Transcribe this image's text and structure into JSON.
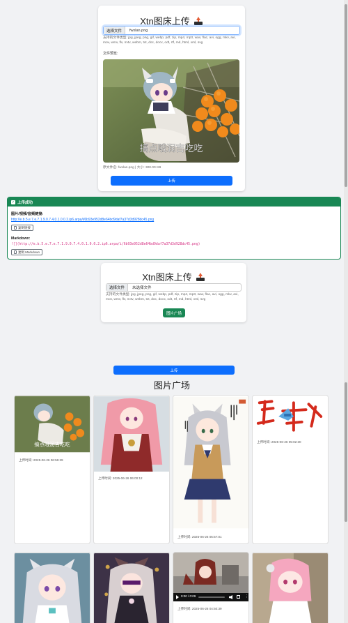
{
  "uploader": {
    "title": "Xtn图床上传",
    "file_button": "选择文件",
    "file_name": "fwxlan.png",
    "supported_types": "支持的文件类型: jpg, jpeg, png, gif, webp, pdf, zip, mp4, mp3, wav, flac, avi, ogg, mkv, avi, mov, wmv, flv, m4v, webm, txt, doc, docx, odt, rtf, md, html, xml, svg",
    "preview_label": "文件预览:",
    "preview_caption": "搞点哦润吉吃吃",
    "file_info": "原文件名: fwxlan.png | 大小: 300.00 KB",
    "upload_button": "上传"
  },
  "result": {
    "header": "上传成功",
    "url_label": "图片/视频/音频链接:",
    "url_value": "http://e.b.5.e.7.e.7.1.9.0.7.4.0.1.0.0.2.ip6.arpa/i/6b93e952d8e64bd9daf7a37d3d928dc45.png",
    "copy_link_button": "复制链接",
    "markdown_label": "Markdown:",
    "markdown_value": "![](http://e.b.5.e.7.e.7.1.9.0.7.4.0.1.0.0.2.ip6.arpa/i/6b93e952d8e64bd9daf7a37d3d928dc45.png)",
    "copy_markdown_button": "复制 Markdown"
  },
  "uploader2": {
    "title": "Xtn图床上传",
    "file_button": "选择文件",
    "file_name": "未选择文件",
    "supported_types": "支持的文件类型: jpg, jpeg, png, gif, webp, pdf, zip, mp4, mp3, wav, flac, avi, ogg, mkv, avi, mov, wmv, flv, m4v, webm, txt, doc, docx, odt, rtf, md, html, xml, svg",
    "gallery_button": "图片广场"
  },
  "bottom_upload_button": "上传",
  "gallery": {
    "title": "图片广场",
    "items": [
      {
        "time": "上传时间: 2025-06-26 06:56:29",
        "caption": "搞点哦润吉吃吃"
      },
      {
        "time": "上传时间: 2025-06-26 06:00:12"
      },
      {
        "time": "上传时间: 2025-06-26 05:57:01"
      },
      {
        "time": "上传时间: 2025-06-26 05:02:30"
      },
      {
        "time": ""
      },
      {
        "time": ""
      },
      {
        "time": "上传时间: 2025-06-26 04:50:39",
        "video_time": "0:00 / 0:09"
      },
      {
        "time": ""
      }
    ]
  },
  "colors": {
    "primary": "#0d6efd",
    "success": "#198754",
    "markdown": "#d63384"
  }
}
